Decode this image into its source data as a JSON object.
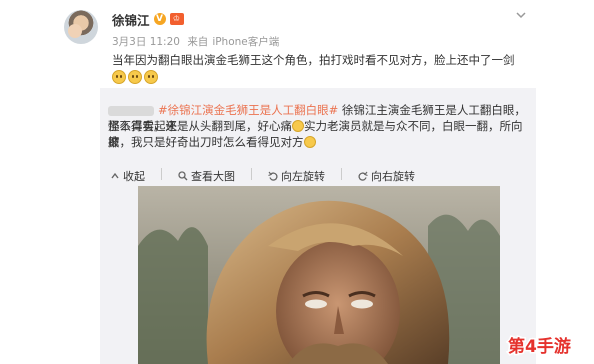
{
  "author": {
    "name": "徐锦江",
    "verified_badge": "V",
    "vip_badge": "♔"
  },
  "meta": {
    "date": "3月3日 11:20",
    "source_prefix": "来自",
    "source": "iPhone客户端"
  },
  "post": {
    "text": "当年因为翻白眼出演金毛狮王这个角色，拍打戏时看不见对方，脸上还中了一剑"
  },
  "repost": {
    "hashtag": "#徐锦江演金毛狮王是人工翻白眼#",
    "line1_rest": " 徐锦江主演金毛狮王是人工翻白眼，怪不得看起来",
    "line2": "那么真实，还是从头翻到尾，好心痛",
    "line2_rest": "实力老演员就是与众不同，白眼一翻，所向披",
    "line3": "靡，我只是好奇出刀时怎么看得见对方"
  },
  "toolbar": {
    "collapse": "收起",
    "view_large": "查看大图",
    "rotate_left": "向左旋转",
    "rotate_right": "向右旋转"
  },
  "watermark": {
    "text": "第4手游"
  },
  "colors": {
    "accent": "#eb7350",
    "watermark": "#e5322d",
    "repost_bg": "#f2f2f5"
  }
}
